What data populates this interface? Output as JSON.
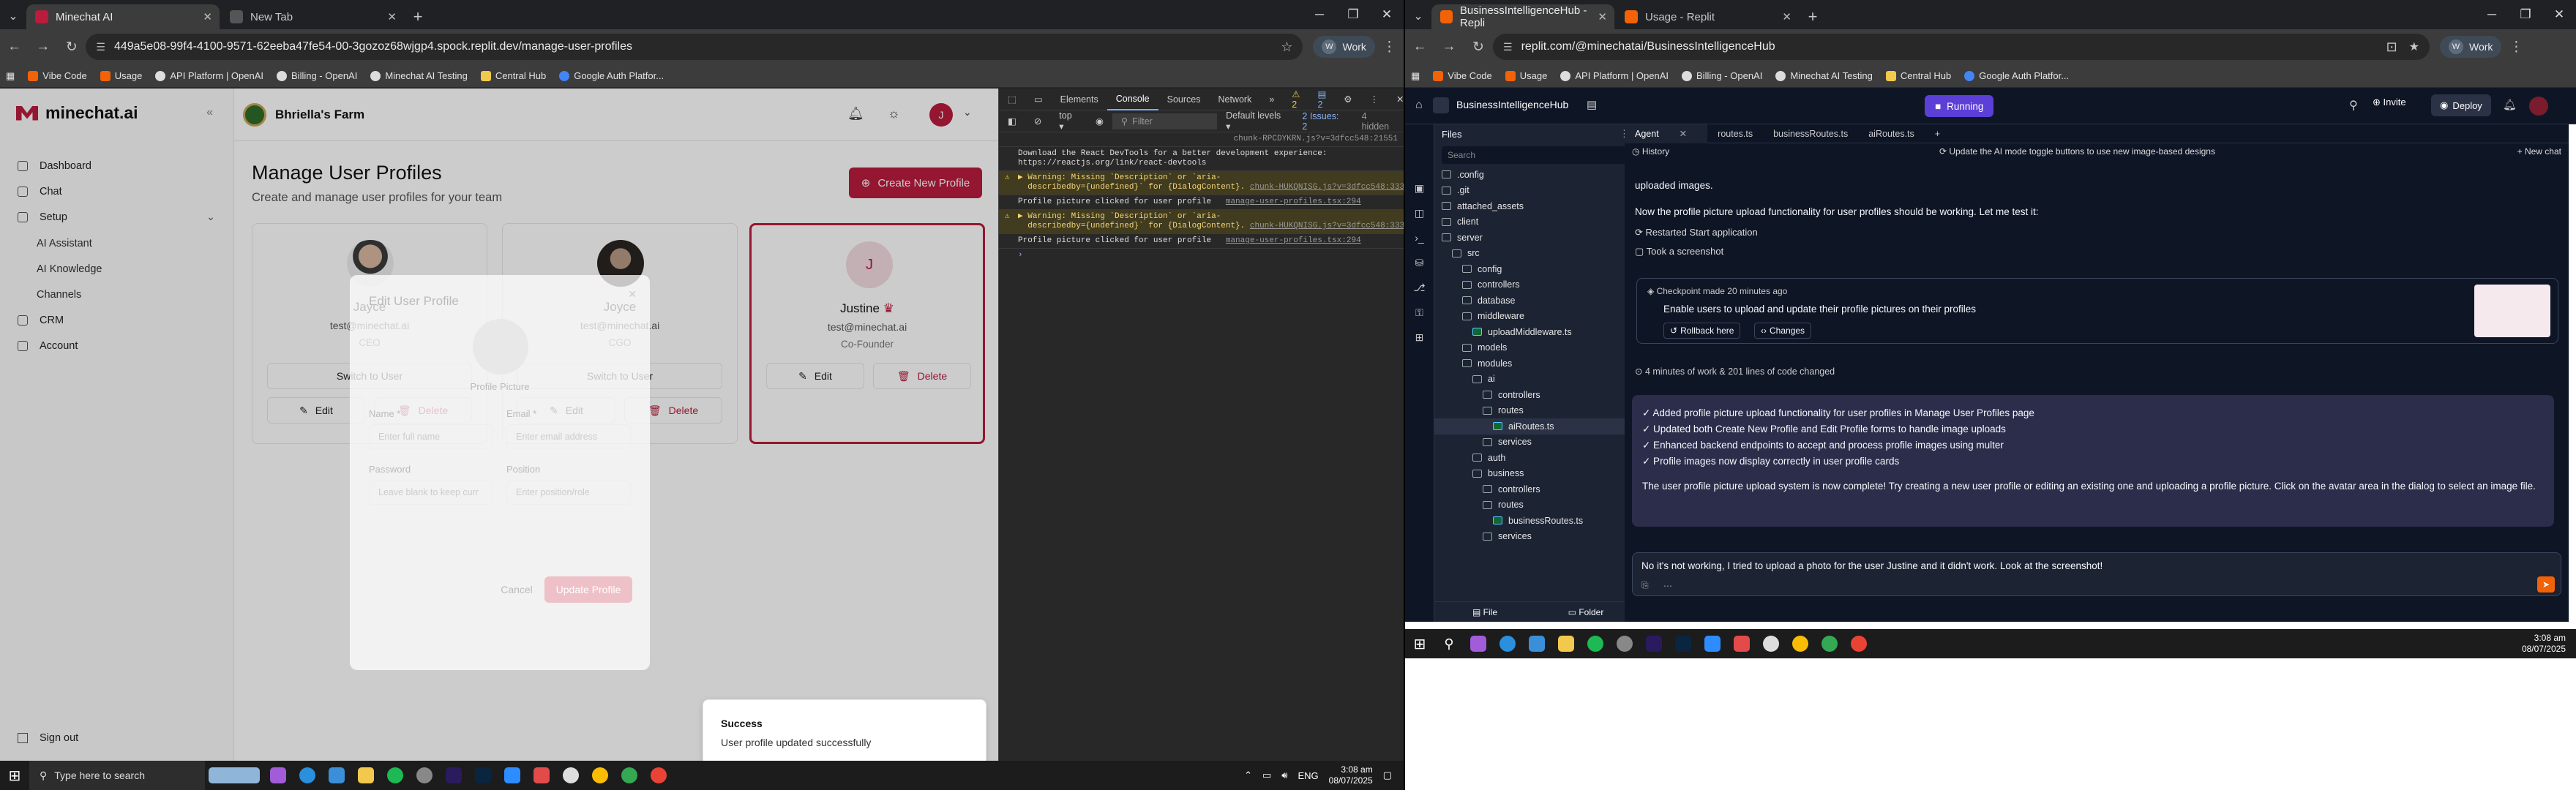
{
  "left_window": {
    "tabs": [
      {
        "label": "Minechat AI",
        "active": true
      },
      {
        "label": "New Tab",
        "active": false
      }
    ],
    "url": "449a5e08-99f4-4100-9571-62eeba47fe54-00-3gozoz68wjgp4.spock.replit.dev/manage-user-profiles",
    "profile": "Work",
    "bookmarks": [
      "Vibe Code",
      "Usage",
      "API Platform | OpenAI",
      "Billing - OpenAI",
      "Minechat AI Testing",
      "Central Hub",
      "Google Auth Platfor..."
    ]
  },
  "app": {
    "logo": "minechat.ai",
    "farm": "Bhriella's Farm",
    "user_initial": "J",
    "nav": {
      "dashboard": "Dashboard",
      "chat": "Chat",
      "setup": "Setup",
      "ai_assistant": "AI Assistant",
      "ai_knowledge": "AI Knowledge",
      "channels": "Channels",
      "crm": "CRM",
      "account": "Account",
      "signout": "Sign out"
    },
    "page_title": "Manage User Profiles",
    "page_subtitle": "Create and manage user profiles for your team",
    "create_button": "Create New Profile",
    "switch_label": "Switch to User",
    "edit_label": "Edit",
    "delete_label": "Delete",
    "cards": [
      {
        "name": "Jayce",
        "email": "test@minechat.ai",
        "role": "CEO",
        "avatar": "photo"
      },
      {
        "name": "Joyce",
        "email": "test@minechat.ai",
        "role": "CGO",
        "avatar": "photo"
      },
      {
        "name": "Justine",
        "email": "test@minechat.ai",
        "role": "Co-Founder",
        "avatar": "J",
        "crown": "♛"
      }
    ],
    "dialog": {
      "title": "Edit User Profile",
      "picture_label": "Profile Picture",
      "name_label": "Name *",
      "name_placeholder": "Enter full name",
      "email_label": "Email *",
      "email_placeholder": "Enter email address",
      "password_label": "Password",
      "password_placeholder": "Leave blank to keep curr",
      "position_label": "Position",
      "position_placeholder": "Enter position/role",
      "cancel": "Cancel",
      "update": "Update Profile"
    },
    "toast": {
      "title": "Success",
      "message": "User profile updated successfully"
    }
  },
  "devtools": {
    "tabs": [
      "Elements",
      "Console",
      "Sources",
      "Network"
    ],
    "active_tab": "Console",
    "context": "top",
    "filter_placeholder": "Filter",
    "levels": "Default levels",
    "issues": "2 Issues: 2",
    "hidden": "4 hidden",
    "warn_count": "2",
    "msg_count": "2",
    "lines": [
      {
        "type": "info",
        "text": "chunk-RPCDYKRN.js?v=3dfcc548:21551",
        "src": ""
      },
      {
        "type": "info",
        "text": "Download the React DevTools for a better development experience:\nhttps://reactjs.org/link/react-devtools",
        "src": ""
      },
      {
        "type": "warn",
        "text": "▶ Warning: Missing `Description` or `aria-\n  describedby={undefined}` for {DialogContent}.",
        "src": "chunk-HUKQNISG.js?v=3dfcc548:333"
      },
      {
        "type": "info",
        "text": "Profile picture clicked for user profile",
        "src": "manage-user-profiles.tsx:294"
      },
      {
        "type": "warn",
        "text": "▶ Warning: Missing `Description` or `aria-\n  describedby={undefined}` for {DialogContent}.",
        "src": "chunk-HUKQNISG.js?v=3dfcc548:333"
      },
      {
        "type": "info",
        "text": "Profile picture clicked for user profile",
        "src": "manage-user-profiles.tsx:294"
      }
    ]
  },
  "right_window": {
    "tabs": [
      {
        "label": "BusinessIntelligenceHub - Repli",
        "active": true
      },
      {
        "label": "Usage - Replit",
        "active": false
      }
    ],
    "url": "replit.com/@minechatai/BusinessIntelligenceHub",
    "profile": "Work",
    "bookmarks": [
      "Vibe Code",
      "Usage",
      "API Platform | OpenAI",
      "Billing - OpenAI",
      "Minechat AI Testing",
      "Central Hub",
      "Google Auth Platfor..."
    ],
    "repl_name": "BusinessIntelligenceHub",
    "status": "Running",
    "invite": "Invite",
    "deploy": "Deploy",
    "files_title": "Files",
    "search_placeholder": "Search",
    "tree": [
      {
        "name": ".config",
        "depth": 0,
        "type": "folder"
      },
      {
        "name": ".git",
        "depth": 0,
        "type": "folder"
      },
      {
        "name": "attached_assets",
        "depth": 0,
        "type": "folder"
      },
      {
        "name": "client",
        "depth": 0,
        "type": "folder"
      },
      {
        "name": "server",
        "depth": 0,
        "type": "folder"
      },
      {
        "name": "src",
        "depth": 1,
        "type": "folder"
      },
      {
        "name": "config",
        "depth": 2,
        "type": "folder"
      },
      {
        "name": "controllers",
        "depth": 2,
        "type": "folder"
      },
      {
        "name": "database",
        "depth": 2,
        "type": "folder"
      },
      {
        "name": "middleware",
        "depth": 2,
        "type": "folder"
      },
      {
        "name": "uploadMiddleware.ts",
        "depth": 3,
        "type": "file"
      },
      {
        "name": "models",
        "depth": 2,
        "type": "folder"
      },
      {
        "name": "modules",
        "depth": 2,
        "type": "folder"
      },
      {
        "name": "ai",
        "depth": 3,
        "type": "folder"
      },
      {
        "name": "controllers",
        "depth": 4,
        "type": "folder"
      },
      {
        "name": "routes",
        "depth": 4,
        "type": "folder"
      },
      {
        "name": "aiRoutes.ts",
        "depth": 5,
        "type": "file",
        "selected": true
      },
      {
        "name": "services",
        "depth": 4,
        "type": "folder"
      },
      {
        "name": "auth",
        "depth": 3,
        "type": "folder"
      },
      {
        "name": "business",
        "depth": 3,
        "type": "folder"
      },
      {
        "name": "controllers",
        "depth": 4,
        "type": "folder"
      },
      {
        "name": "routes",
        "depth": 4,
        "type": "folder"
      },
      {
        "name": "businessRoutes.ts",
        "depth": 5,
        "type": "file"
      },
      {
        "name": "services",
        "depth": 4,
        "type": "folder"
      }
    ],
    "file_btn": "File",
    "folder_btn": "Folder",
    "editor_tabs": [
      "Agent",
      "routes.ts",
      "businessRoutes.ts",
      "aiRoutes.ts"
    ],
    "history": "History",
    "history_title": "Update the AI mode toggle buttons to use new image-based designs",
    "new_chat": "New chat",
    "agent_lines": {
      "l1": "uploaded images.",
      "l2": "Now the profile picture upload functionality for user profiles should be working. Let me test it:",
      "restarted": "Restarted Start application",
      "screenshot": "Took a screenshot",
      "checkpoint": "Checkpoint made 20 minutes ago",
      "checkpoint_desc": "Enable users to upload and update their profile pictures on their profiles",
      "rollback": "Rollback here",
      "changes": "Changes",
      "work": "4 minutes of work & 201 lines of code changed"
    },
    "summary": [
      "✓ Added profile picture upload functionality for user profiles in Manage User Profiles page",
      "✓ Updated both Create New Profile and Edit Profile forms to handle image uploads",
      "✓ Enhanced backend endpoints to accept and process profile images using multer",
      "✓ Profile images now display correctly in user profile cards"
    ],
    "summary_text": "The user profile picture upload system is now complete! Try creating a new user profile or editing an existing one and uploading a profile picture. Click on the avatar area in the dialog to select an image file.",
    "user_message": "No it's not working, I tried to upload a photo for the user Justine and it didn't work. Look at the screenshot!"
  },
  "taskbar": {
    "search_placeholder": "Type here to search",
    "time": "3:08 am",
    "date": "08/07/2025",
    "lang": "ENG"
  }
}
